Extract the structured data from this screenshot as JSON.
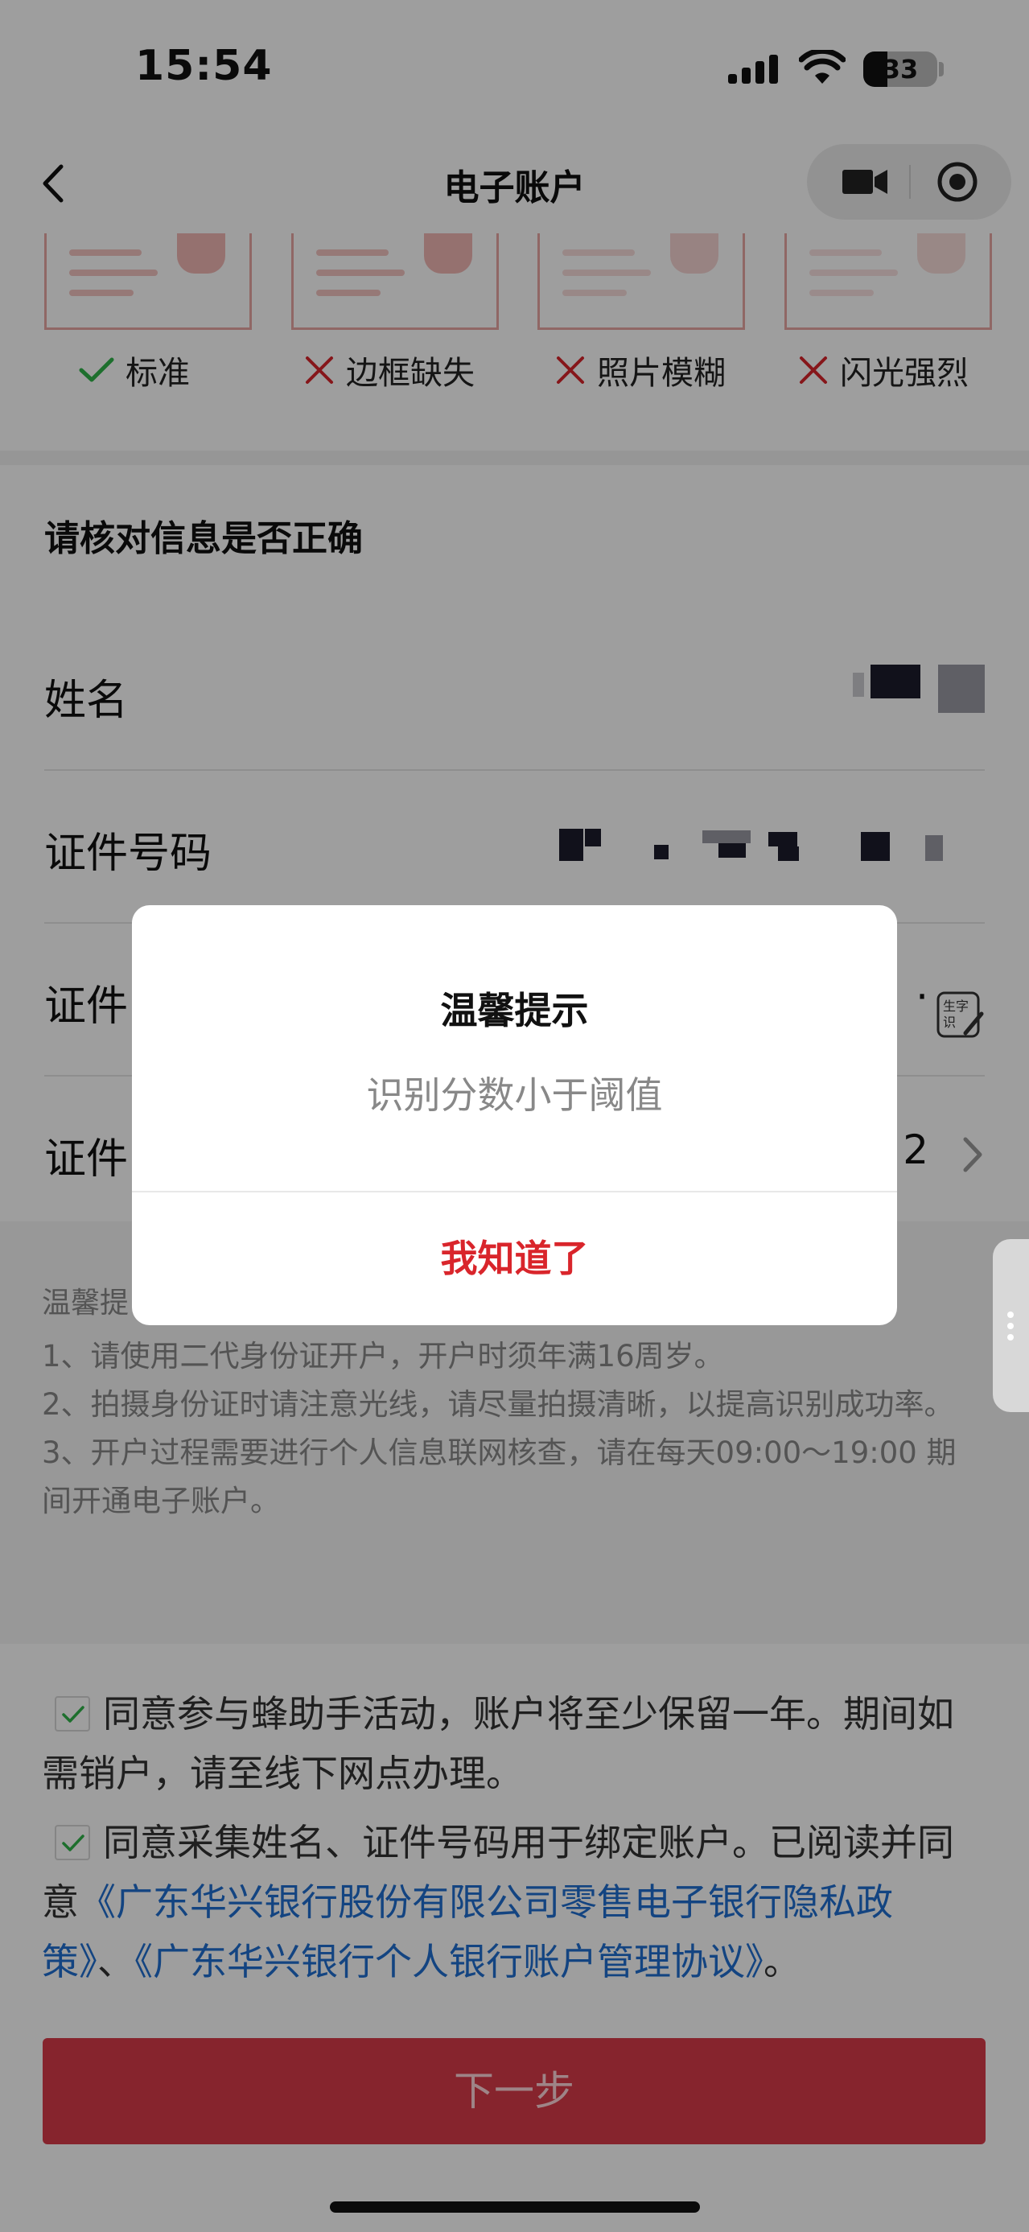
{
  "status_bar": {
    "time": "15:54",
    "battery": "33",
    "battery_level": 0.33
  },
  "nav": {
    "title": "电子账户"
  },
  "samples": [
    {
      "label": "标准",
      "status": "ok"
    },
    {
      "label": "边框缺失",
      "status": "bad"
    },
    {
      "label": "照片模糊",
      "status": "bad"
    },
    {
      "label": "闪光强烈",
      "status": "bad"
    }
  ],
  "verify": {
    "title": "请核对信息是否正确",
    "name_label": "姓名",
    "id_label": "证件号码",
    "row3_label": "证件",
    "row3_trail": "·",
    "row4_label": "证件",
    "row4_trail": "2"
  },
  "tips": {
    "title": "温馨提",
    "lines": [
      "1、请使用二代身份证开户，开户时须年满16周岁。",
      "2、拍摄身份证时请注意光线，请尽量拍摄清晰，以提高识别成功率。",
      "3、开户过程需要进行个人信息联网核查，请在每天09:00～19:00 期间开通电子账户。"
    ]
  },
  "agreements": {
    "item1": "同意参与蜂助手活动，账户将至少保留一年。期间如需销户，请至线下网点办理。",
    "item2_prefix": "同意采集姓名、证件号码用于绑定账户。已阅读并同意",
    "link1": "《广东华兴银行股份有限公司零售电子银行隐私政策》",
    "sep": "、",
    "link2": "《广东华兴银行个人银行账户管理协议》",
    "end": "。"
  },
  "next_button": "下一步",
  "dialog": {
    "title": "温馨提示",
    "message": "识别分数小于阈值",
    "button": "我知道了"
  },
  "colors": {
    "accent_red": "#d9252b",
    "link_blue": "#1f6fd1",
    "check_green": "#2fb34a"
  }
}
